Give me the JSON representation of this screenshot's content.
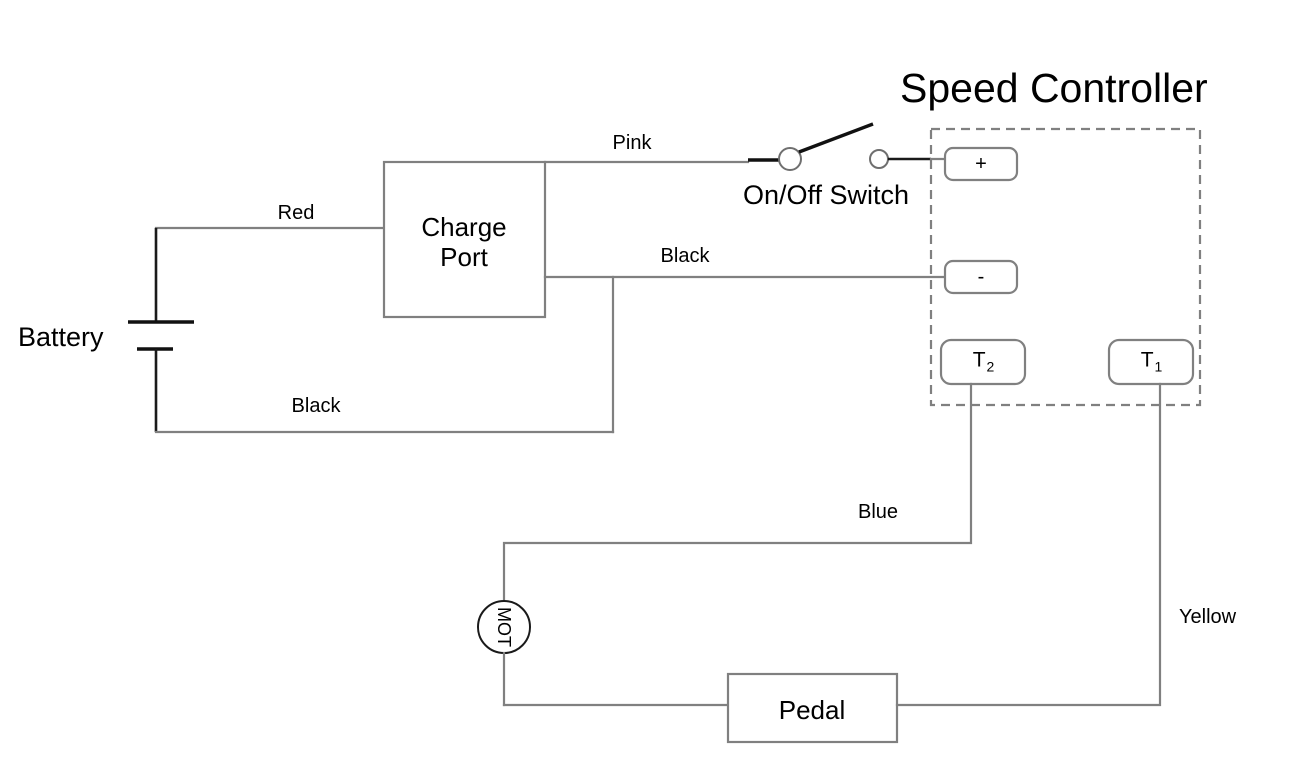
{
  "diagram": {
    "title": "Speed Controller",
    "nodes": {
      "battery": "Battery",
      "charge_port_line1": "Charge",
      "charge_port_line2": "Port",
      "switch": "On/Off Switch",
      "motor": "MOT",
      "pedal": "Pedal"
    },
    "controller_terminals": [
      {
        "id": "plus",
        "label": "+"
      },
      {
        "id": "minus",
        "label": "-"
      },
      {
        "id": "t2",
        "label": "T",
        "sub": "2"
      },
      {
        "id": "t1",
        "label": "T",
        "sub": "1"
      }
    ],
    "wire_labels": [
      {
        "id": "red",
        "label": "Red"
      },
      {
        "id": "pink",
        "label": "Pink"
      },
      {
        "id": "black_top",
        "label": "Black"
      },
      {
        "id": "black_bottom",
        "label": "Black"
      },
      {
        "id": "blue",
        "label": "Blue"
      },
      {
        "id": "yellow",
        "label": "Yellow"
      }
    ],
    "colors": {
      "wire_stroke": "#808080",
      "black_stroke": "#1a1a1a",
      "background": "#ffffff",
      "text": "#000000"
    }
  }
}
